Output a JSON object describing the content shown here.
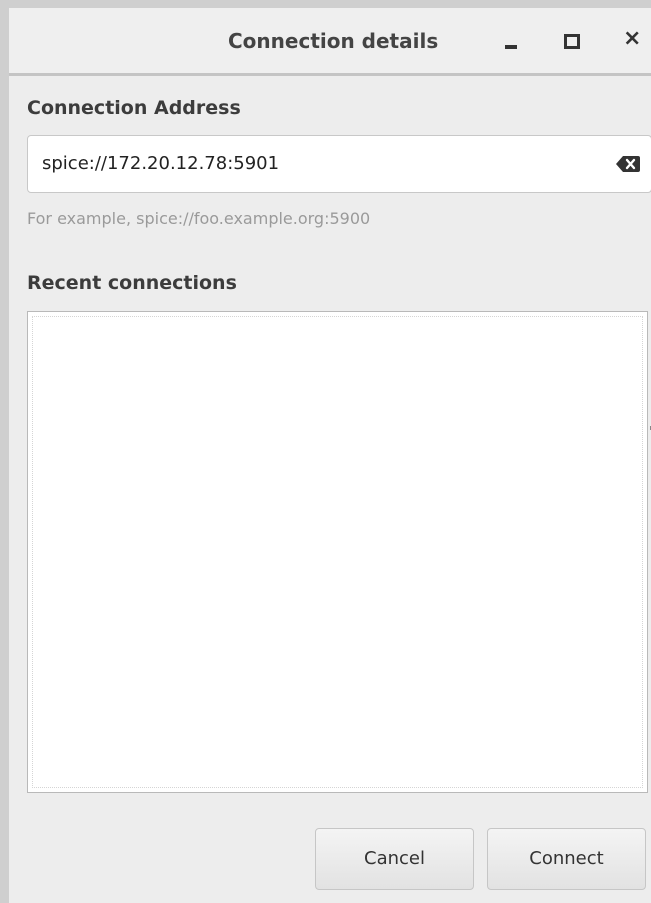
{
  "window": {
    "title": "Connection details",
    "minimize_icon": "minimize-icon",
    "maximize_icon": "maximize-icon",
    "close_icon": "close-icon",
    "close_glyph": "×"
  },
  "address": {
    "label": "Connection Address",
    "value": "spice://172.20.12.78:5901",
    "clear_icon": "backspace-clear-icon",
    "hint": "For example, spice://foo.example.org:5900"
  },
  "recent": {
    "label": "Recent connections",
    "items": []
  },
  "actions": {
    "cancel_label": "Cancel",
    "connect_label": "Connect"
  },
  "colors": {
    "window_bg": "#ededed",
    "titlebar_bg": "#efefef",
    "border": "#cfcfcf",
    "text": "#3c3c3c",
    "hint_text": "#9a9a9a",
    "field_bg": "#ffffff"
  }
}
